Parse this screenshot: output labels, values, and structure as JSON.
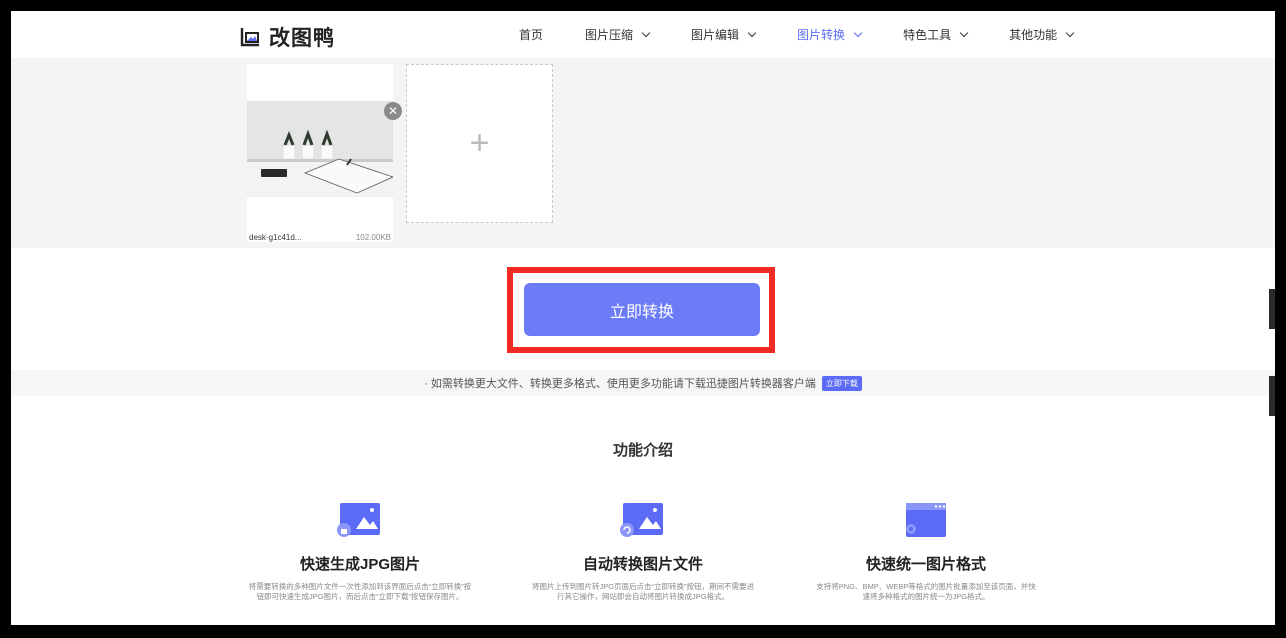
{
  "brand": {
    "name": "改图鸭"
  },
  "nav": [
    {
      "label": "首页",
      "dropdown": false,
      "active": false
    },
    {
      "label": "图片压缩",
      "dropdown": true,
      "active": false
    },
    {
      "label": "图片编辑",
      "dropdown": true,
      "active": false
    },
    {
      "label": "图片转换",
      "dropdown": true,
      "active": true
    },
    {
      "label": "特色工具",
      "dropdown": true,
      "active": false
    },
    {
      "label": "其他功能",
      "dropdown": true,
      "active": false
    }
  ],
  "upload": {
    "file": {
      "name": "desk-g1c41d...",
      "size": "102.00KB"
    },
    "add_label": "+"
  },
  "convert_button": "立即转换",
  "notice": {
    "text": "· 如需转换更大文件、转换更多格式、使用更多功能请下载迅捷图片转换器客户端",
    "button": "立即下载"
  },
  "features": {
    "title": "功能介绍",
    "items": [
      {
        "title": "快速生成JPG图片",
        "desc": "将需要转换的多种图片文件一次性添加到该界面后点击“立即转换”按钮即可快速生成JPG图片，而后点击“立即下载”按钮保存图片。"
      },
      {
        "title": "自动转换图片文件",
        "desc": "将图片上传到图片转JPG页面后点击“立即转换”按钮，期间不需要进行其它操作，网站即会自动将图片转换成JPG格式。"
      },
      {
        "title": "快速统一图片格式",
        "desc": "支持将PNG、BMP、WEBP等格式的图片批量添加至该页面，并快速将多种格式的图片统一为JPG格式。"
      }
    ]
  },
  "colors": {
    "accent": "#6c7cf7",
    "nav_active": "#5b6bf5",
    "highlight": "#f02b24"
  }
}
